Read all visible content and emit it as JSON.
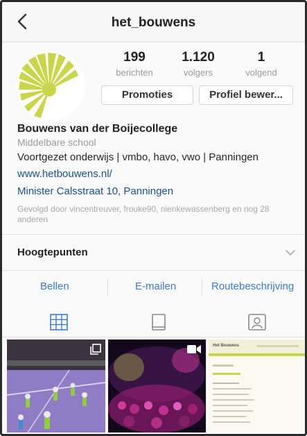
{
  "header": {
    "back_icon": "chevron-left-icon",
    "username": "het_bouwens"
  },
  "stats": {
    "posts": {
      "value": "199",
      "label": "berichten"
    },
    "followers": {
      "value": "1.120",
      "label": "volgers"
    },
    "following": {
      "value": "1",
      "label": "volgend"
    }
  },
  "buttons": {
    "promotions": "Promoties",
    "edit_profile": "Profiel bewer..."
  },
  "bio": {
    "name": "Bouwens van der Boijecollege",
    "category": "Middelbare school",
    "description": "Voortgezet onderwijs | vmbo, havo, vwo | Panningen",
    "website": "www.hetbouwens.nl/",
    "address": "Minister Calsstraat 10, Panningen",
    "followed_by": "Gevolgd door vincentreuver, frouke90, nienkewassenberg en nog 28 anderen"
  },
  "highlights": {
    "label": "Hoogtepunten",
    "toggle_icon": "chevron-down-icon"
  },
  "contact_actions": {
    "call": "Bellen",
    "email": "E-mailen",
    "directions": "Routebeschrijving"
  },
  "tabs": [
    {
      "icon": "grid-icon",
      "active": true
    },
    {
      "icon": "feed-icon",
      "active": false
    },
    {
      "icon": "tagged-icon",
      "active": false
    }
  ],
  "posts": [
    {
      "subject": "sports-hall-photo",
      "icon": "multi-photo-icon"
    },
    {
      "subject": "party-crowd-video",
      "icon": "video-icon"
    },
    {
      "subject": "website-screenshot",
      "heading": "Het Bouwens"
    }
  ],
  "colors": {
    "link": "#1a4f8c",
    "action": "#3b7ad0",
    "logo_green": "#c9d64a",
    "active_tab": "#3b7ad0"
  }
}
